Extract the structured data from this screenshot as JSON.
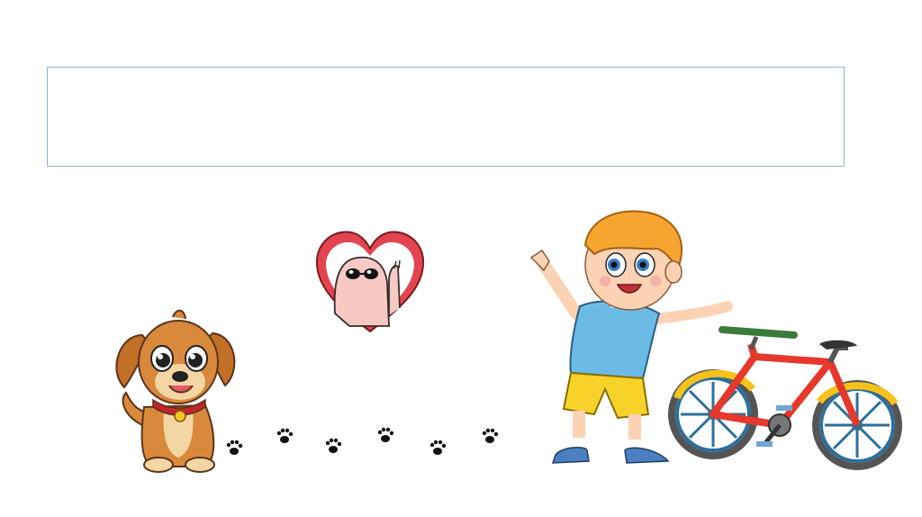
{
  "slide": {
    "title_text": ""
  },
  "illustrations": {
    "dog": "puppy-illustration",
    "heart": "heart-character-illustration",
    "boy": "boy-illustration",
    "bicycle": "bicycle-illustration",
    "paws": "paw-prints"
  },
  "colors": {
    "title_border": "#8fb4d6",
    "heart_red": "#e2454f",
    "bike_red": "#e6382b",
    "dog_fur": "#d9893c",
    "boy_shirt": "#6bbbe6",
    "boy_shorts": "#f7d229"
  }
}
